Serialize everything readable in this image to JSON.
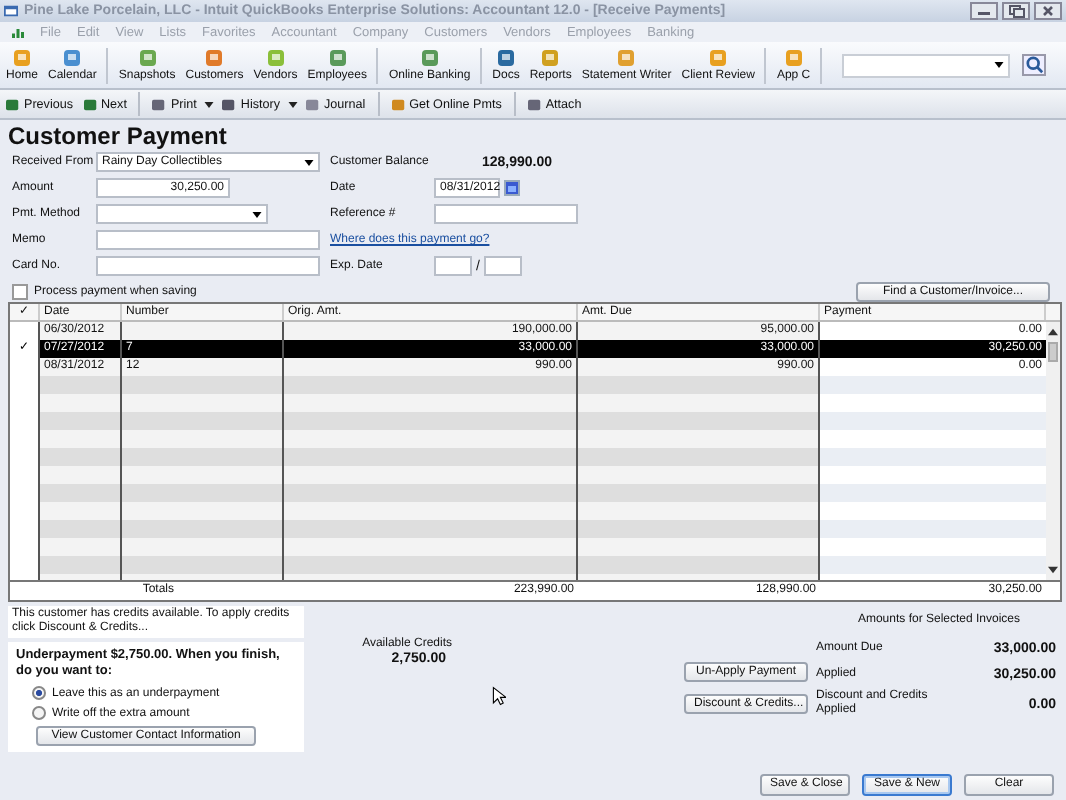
{
  "window": {
    "title": "Pine Lake Porcelain, LLC  - Intuit QuickBooks Enterprise Solutions: Accountant 12.0 - [Receive Payments]"
  },
  "menu": [
    "File",
    "Edit",
    "View",
    "Lists",
    "Favorites",
    "Accountant",
    "Company",
    "Customers",
    "Vendors",
    "Employees",
    "Banking"
  ],
  "toolbar": [
    [
      "Home",
      "Calendar"
    ],
    [
      "Snapshots",
      "Customers",
      "Vendors",
      "Employees"
    ],
    [
      "Online Banking"
    ],
    [
      "Docs",
      "Reports",
      "Statement Writer",
      "Client Review"
    ],
    [
      "App C"
    ]
  ],
  "action_bar": [
    {
      "label": "Previous",
      "dropdown": false
    },
    {
      "label": "Next",
      "dropdown": false
    },
    {
      "label": "Print",
      "dropdown": true
    },
    {
      "label": "History",
      "dropdown": true
    },
    {
      "label": "Journal",
      "dropdown": false
    },
    {
      "label": "Get Online Pmts",
      "dropdown": false
    },
    {
      "label": "Attach",
      "dropdown": false
    }
  ],
  "form": {
    "heading": "Customer Payment",
    "received_from": {
      "label": "Received From",
      "value": "Rainy Day Collectibles"
    },
    "customer_balance": {
      "label": "Customer Balance",
      "value": "128,990.00"
    },
    "amount": {
      "label": "Amount",
      "value": "30,250.00"
    },
    "date": {
      "label": "Date",
      "value": "08/31/2012"
    },
    "pmt_method": {
      "label": "Pmt. Method"
    },
    "reference": {
      "label": "Reference #"
    },
    "memo": {
      "label": "Memo"
    },
    "help_link": "Where does this payment go?",
    "card_no": {
      "label": "Card No."
    },
    "exp_date": {
      "label": "Exp. Date",
      "separator": "/"
    },
    "process_payment": {
      "label": "Process  payment when saving",
      "checked": false
    },
    "find_button": "Find a Customer/Invoice..."
  },
  "table": {
    "check_header": "✓",
    "columns": [
      "Date",
      "Number",
      "Orig. Amt.",
      "Amt. Due",
      "Payment"
    ],
    "rows": [
      {
        "checked": false,
        "selected": false,
        "cells": [
          "06/30/2012",
          "",
          "190,000.00",
          "95,000.00",
          "0.00"
        ]
      },
      {
        "checked": true,
        "selected": true,
        "cells": [
          "07/27/2012",
          "7",
          "33,000.00",
          "33,000.00",
          "30,250.00"
        ]
      },
      {
        "checked": false,
        "selected": false,
        "cells": [
          "08/31/2012",
          "12",
          "990.00",
          "990.00",
          "0.00"
        ]
      }
    ],
    "totals": {
      "label": "Totals",
      "values": [
        "223,990.00",
        "128,990.00",
        "30,250.00"
      ]
    }
  },
  "credits_note": "This customer has credits available. To apply credits click Discount & Credits...",
  "underpayment": {
    "message": "Underpayment $2,750.00. When you finish, do you want to:",
    "options": [
      {
        "label": "Leave this as an underpayment",
        "selected": true
      },
      {
        "label": "Write off the extra amount",
        "selected": false
      }
    ],
    "contact_button": "View Customer Contact Information"
  },
  "available_credits": {
    "label": "Available Credits",
    "value": "2,750.00"
  },
  "side_buttons": [
    "Un-Apply Payment",
    "Discount & Credits..."
  ],
  "amounts": {
    "heading": "Amounts for Selected Invoices",
    "items": [
      {
        "label": "Amount Due",
        "value": "33,000.00"
      },
      {
        "label": "Applied",
        "value": "30,250.00"
      },
      {
        "label": "Discount and Credits Applied",
        "value": "0.00"
      }
    ]
  },
  "footer_buttons": [
    {
      "label": "Save & Close",
      "default": false
    },
    {
      "label": "Save & New",
      "default": true
    },
    {
      "label": "Clear",
      "default": false
    }
  ]
}
